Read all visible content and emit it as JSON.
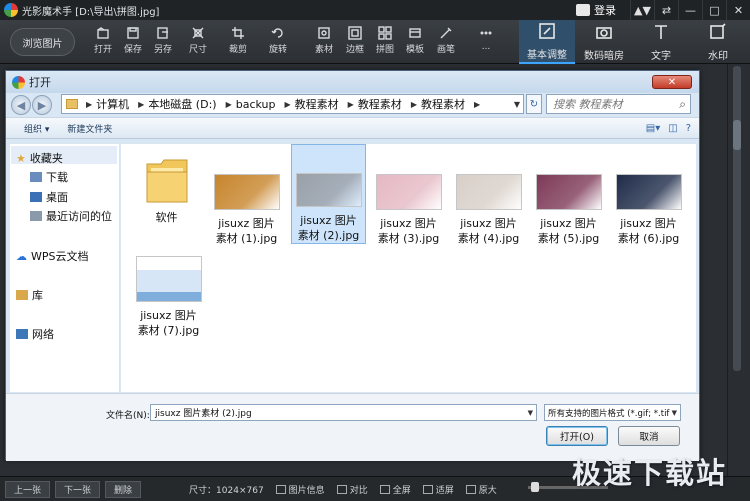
{
  "app": {
    "title": "光影魔术手 [D:\\导出\\拼图.jpg]",
    "login": "登录",
    "window_controls": [
      "▲▼",
      "⇄",
      "—",
      "□",
      "✕"
    ],
    "browse_button": "浏览图片"
  },
  "toolbar": {
    "tools": [
      {
        "label": "打开",
        "icon": "open-icon"
      },
      {
        "label": "保存",
        "icon": "save-icon"
      },
      {
        "label": "另存",
        "icon": "save-as-icon"
      },
      {
        "label": "尺寸",
        "icon": "resize-icon"
      },
      {
        "label": "裁剪",
        "icon": "crop-icon"
      },
      {
        "label": "旋转",
        "icon": "rotate-icon"
      },
      {
        "label": "素材",
        "icon": "material-icon"
      },
      {
        "label": "边框",
        "icon": "border-icon"
      },
      {
        "label": "拼图",
        "icon": "collage-icon"
      },
      {
        "label": "模板",
        "icon": "template-icon"
      },
      {
        "label": "画笔",
        "icon": "brush-icon"
      },
      {
        "label": "...",
        "icon": "more-icon"
      }
    ],
    "right_tabs": [
      {
        "label": "基本调整",
        "icon": "basic-adjust-icon",
        "active": true
      },
      {
        "label": "数码暗房",
        "icon": "darkroom-icon",
        "active": false
      },
      {
        "label": "文字",
        "icon": "text-icon",
        "active": false
      },
      {
        "label": "水印",
        "icon": "watermark-icon",
        "active": false
      }
    ]
  },
  "dialog": {
    "title": "打开",
    "close": "✕",
    "breadcrumb": [
      "计算机",
      "本地磁盘 (D:)",
      "backup",
      "教程素材",
      "教程素材",
      "教程素材"
    ],
    "search_placeholder": "搜索 教程素材",
    "commands": {
      "organize": "组织 ▾",
      "new_folder": "新建文件夹"
    },
    "nav": {
      "favorites": "收藏夹",
      "downloads": "下载",
      "desktop": "桌面",
      "recent": "最近访问的位",
      "wps": "WPS云文档",
      "library": "库",
      "network": "网络"
    },
    "files": [
      {
        "name": "软件",
        "type": "folder"
      },
      {
        "name": "jisuxz 图片素材 (1).jpg",
        "line1": "jisuxz 图片",
        "line2": "素材 (1).jpg",
        "color": "#c7852c"
      },
      {
        "name": "jisuxz 图片素材 (2).jpg",
        "line1": "jisuxz 图片",
        "line2": "素材 (2).jpg",
        "color": "#9aa0a8",
        "selected": true
      },
      {
        "name": "jisuxz 图片素材 (3).jpg",
        "line1": "jisuxz 图片",
        "line2": "素材 (3).jpg",
        "color": "#e5b9c4"
      },
      {
        "name": "jisuxz 图片素材 (4).jpg",
        "line1": "jisuxz 图片",
        "line2": "素材 (4).jpg",
        "color": "#d8cfc8"
      },
      {
        "name": "jisuxz 图片素材 (5).jpg",
        "line1": "jisuxz 图片",
        "line2": "素材 (5).jpg",
        "color": "#7e3a58"
      },
      {
        "name": "jisuxz 图片素材 (6).jpg",
        "line1": "jisuxz 图片",
        "line2": "素材 (6).jpg",
        "color": "#1f2c4a"
      },
      {
        "name": "jisuxz 图片素材 (7).jpg",
        "line1": "jisuxz 图片",
        "line2": "素材 (7).jpg",
        "color": "#e4eef8"
      }
    ],
    "filename_label": "文件名(N):",
    "filename_value": "jisuxz 图片素材 (2).jpg",
    "filetype_value": "所有支持的图片格式 (*.gif; *.tif",
    "open_button": "打开(O)",
    "cancel_button": "取消"
  },
  "status": {
    "prev": "上一张",
    "next": "下一张",
    "delete": "删除",
    "size": "尺寸：1024×767",
    "info": "图片信息",
    "compare": "对比",
    "fullscreen": "全屏",
    "fit": "适屏",
    "original": "原大"
  },
  "watermark": "极速下载站"
}
